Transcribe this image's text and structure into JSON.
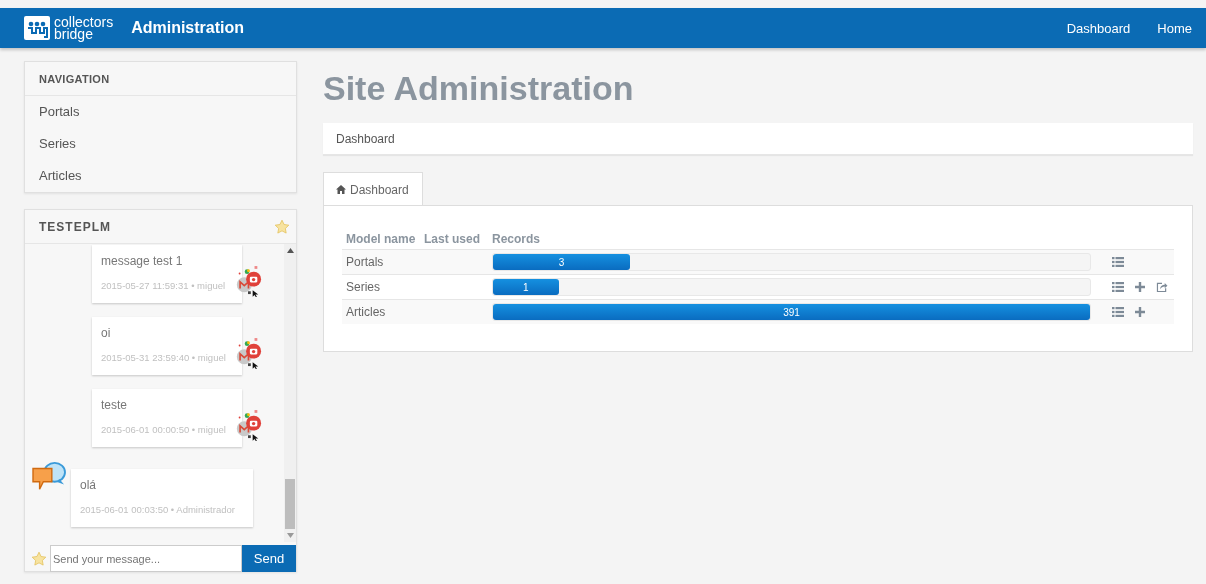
{
  "topbar": {
    "logo_line1": "collectors",
    "logo_line2": "bridge",
    "title": "Administration",
    "links": [
      "Dashboard",
      "Home"
    ]
  },
  "navigation": {
    "title": "NAVIGATION",
    "items": [
      "Portals",
      "Series",
      "Articles"
    ]
  },
  "chat": {
    "title": "TESTEPLM",
    "messages": [
      {
        "text": "message test 1",
        "meta": "2015-05-27 11:59:31 • miguel",
        "kind": "incoming"
      },
      {
        "text": "oi",
        "meta": "2015-05-31 23:59:40 • miguel",
        "kind": "incoming"
      },
      {
        "text": "teste",
        "meta": "2015-06-01 00:00:50 • miguel",
        "kind": "incoming"
      },
      {
        "text": "olá",
        "meta": "2015-06-01 00:03:50 • Administrador",
        "kind": "own"
      }
    ],
    "input": {
      "placeholder": "Send your message..."
    },
    "send": "Send"
  },
  "main": {
    "title": "Site Administration",
    "breadcrumb": "Dashboard",
    "tab": {
      "label": "Dashboard",
      "selected": true
    },
    "table": {
      "columns": [
        "Model name",
        "Last used",
        "Records"
      ],
      "rows": [
        {
          "name": "Portals",
          "records": "3",
          "level": 0.23,
          "actions": [
            {
              "kind": "list"
            }
          ]
        },
        {
          "name": "Series",
          "records": "1",
          "level": 0.11,
          "actions": [
            {
              "kind": "list"
            },
            {
              "kind": "add"
            },
            {
              "kind": "export"
            }
          ]
        },
        {
          "name": "Articles",
          "records": "391",
          "level": 1.0,
          "actions": [
            {
              "kind": "list"
            },
            {
              "kind": "add"
            }
          ]
        }
      ]
    }
  }
}
